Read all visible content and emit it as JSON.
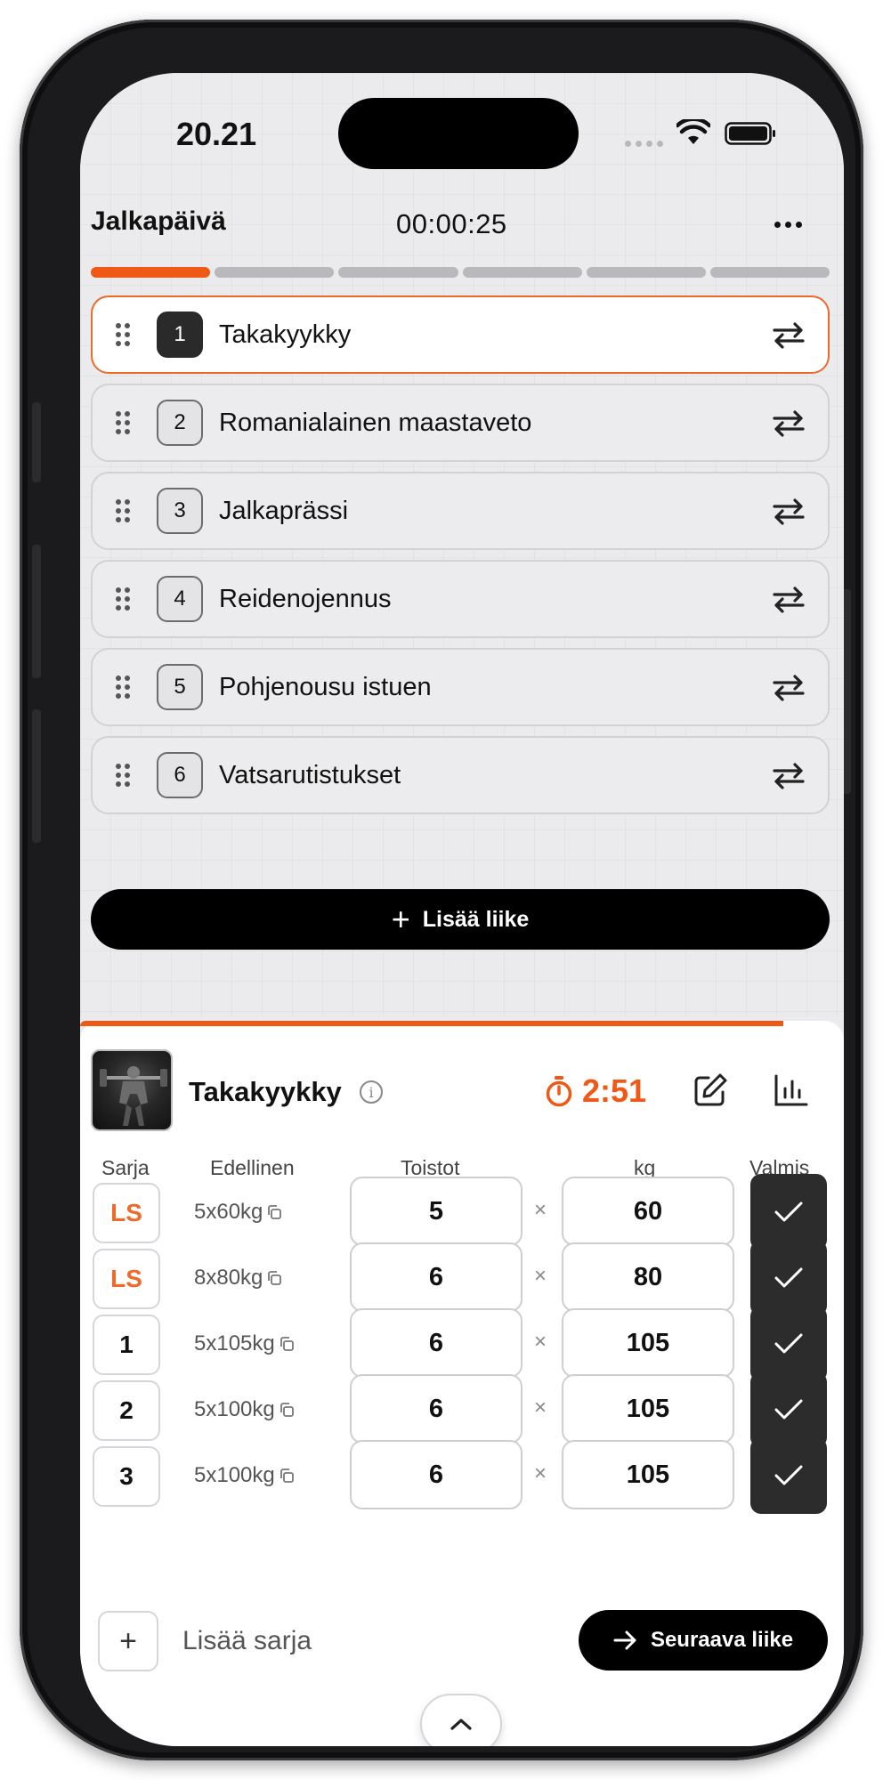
{
  "status_bar": {
    "time": "20.21"
  },
  "header": {
    "title": "Jalkapäivä",
    "timer": "00:00:25",
    "progress": {
      "total_segments": 6,
      "completed_segments": 1
    }
  },
  "exercises": [
    {
      "number": "1",
      "name": "Takakyykky",
      "active": true
    },
    {
      "number": "2",
      "name": "Romanialainen maastaveto",
      "active": false
    },
    {
      "number": "3",
      "name": "Jalkaprässi",
      "active": false
    },
    {
      "number": "4",
      "name": "Reidenojennus",
      "active": false
    },
    {
      "number": "5",
      "name": "Pohjenousu istuen",
      "active": false
    },
    {
      "number": "6",
      "name": "Vatsarutistukset",
      "active": false
    }
  ],
  "add_exercise_label": "Lisää liike",
  "current_exercise": {
    "name": "Takakyykky",
    "rest_timer": "2:51",
    "columns": {
      "set": "Sarja",
      "previous": "Edellinen",
      "reps": "Toistot",
      "weight": "kg",
      "done": "Valmis"
    },
    "times_symbol": "×",
    "sets": [
      {
        "label": "LS",
        "previous": "5x60kg",
        "reps": "5",
        "kg": "60",
        "warmup": true
      },
      {
        "label": "LS",
        "previous": "8x80kg",
        "reps": "6",
        "kg": "80",
        "warmup": true
      },
      {
        "label": "1",
        "previous": "5x105kg",
        "reps": "6",
        "kg": "105",
        "warmup": false
      },
      {
        "label": "2",
        "previous": "5x100kg",
        "reps": "6",
        "kg": "105",
        "warmup": false
      },
      {
        "label": "3",
        "previous": "5x100kg",
        "reps": "6",
        "kg": "105",
        "warmup": false
      }
    ],
    "add_set_label": "Lisää sarja",
    "next_label": "Seuraava liike"
  },
  "colors": {
    "accent": "#ee5a16",
    "dark": "#2c2c2c"
  }
}
